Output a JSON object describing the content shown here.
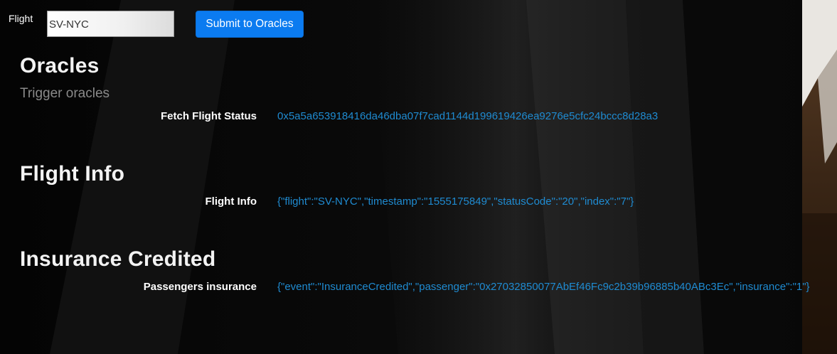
{
  "form": {
    "flight_label": "Flight",
    "flight_input_value": "SV-NYC",
    "submit_label": "Submit to Oracles"
  },
  "oracles": {
    "title": "Oracles",
    "subtitle": "Trigger oracles",
    "rows": [
      {
        "label": "Fetch Flight Status",
        "value": "0x5a5a653918416da46dba07f7cad1144d199619426ea9276e5cfc24bccc8d28a3"
      }
    ]
  },
  "flight_info": {
    "title": "Flight Info",
    "rows": [
      {
        "label": "Flight Info",
        "value": "{\"flight\":\"SV-NYC\",\"timestamp\":\"1555175849\",\"statusCode\":\"20\",\"index\":\"7\"}"
      }
    ]
  },
  "insurance": {
    "title": "Insurance Credited",
    "rows": [
      {
        "label": "Passengers insurance",
        "value": "{\"event\":\"InsuranceCredited\",\"passenger\":\"0x27032850077AbEf46Fc9c2b39b96885b40ABc3Ec\",\"insurance\":\"1\"}"
      }
    ]
  },
  "colors": {
    "accent_button": "#0b7bf0",
    "value_text": "#1f8bd1",
    "subtitle_text": "#8a8a8a"
  }
}
